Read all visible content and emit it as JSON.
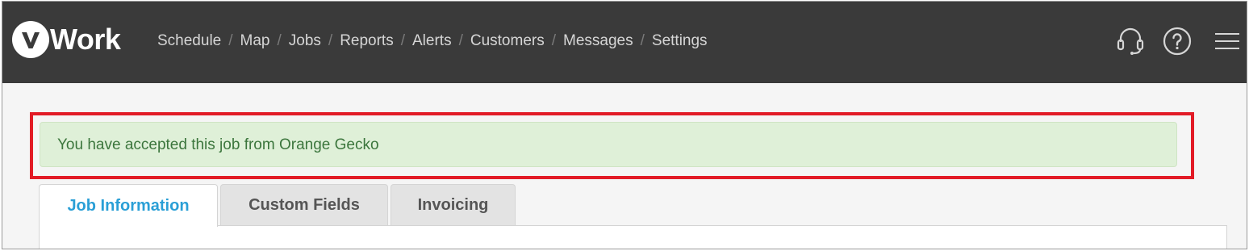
{
  "brand": {
    "logo_letter": "v",
    "logo_text": "Work"
  },
  "nav": {
    "items": [
      {
        "label": "Schedule"
      },
      {
        "label": "Map"
      },
      {
        "label": "Jobs"
      },
      {
        "label": "Reports"
      },
      {
        "label": "Alerts"
      },
      {
        "label": "Customers"
      },
      {
        "label": "Messages"
      },
      {
        "label": "Settings"
      }
    ],
    "separator": "/"
  },
  "toolbar": {
    "support_icon": "headset-icon",
    "help_icon": "help-circle-icon",
    "menu_icon": "hamburger-menu-icon"
  },
  "alert": {
    "message": "You have accepted this job from Orange Gecko"
  },
  "tabs": [
    {
      "label": "Job Information",
      "active": true
    },
    {
      "label": "Custom Fields",
      "active": false
    },
    {
      "label": "Invoicing",
      "active": false
    }
  ],
  "colors": {
    "topbar": "#3a3a3a",
    "alert_bg": "#dff0d8",
    "alert_text": "#3c763d",
    "highlight_border": "#e21b26",
    "active_tab": "#2a9fd6"
  }
}
